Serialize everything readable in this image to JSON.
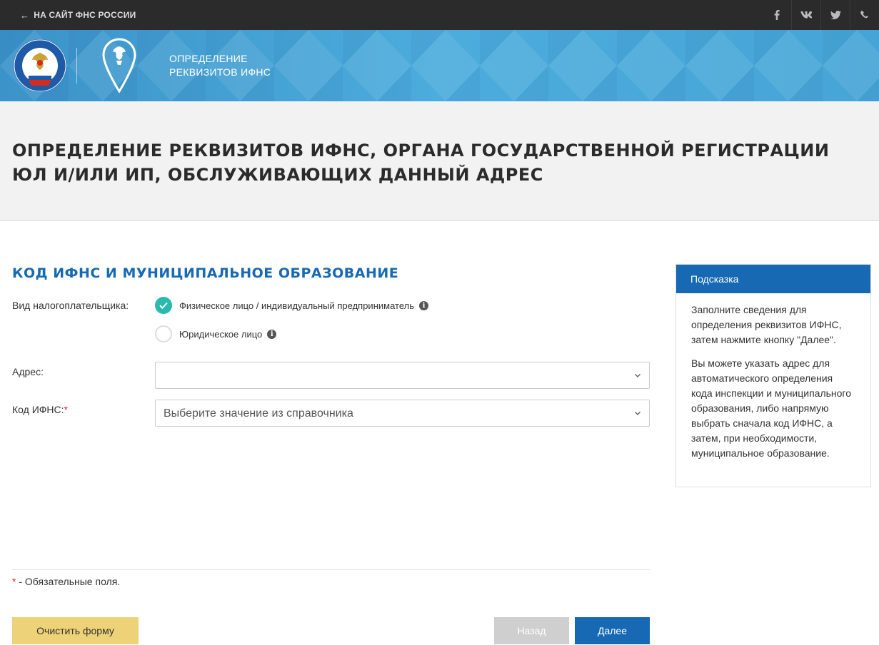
{
  "topbar": {
    "back_link": "НА САЙТ ФНС РОССИИ",
    "social": [
      {
        "icon": "facebook-icon",
        "glyph": "f"
      },
      {
        "icon": "vk-icon",
        "glyph": "vk"
      },
      {
        "icon": "twitter-icon",
        "glyph": "🐦"
      },
      {
        "icon": "phone-icon",
        "glyph": "📞"
      }
    ]
  },
  "banner": {
    "logo_text": "ФЕДЕРАЛЬНАЯ НАЛОГОВАЯ СЛУЖБА",
    "service_line1": "ОПРЕДЕЛЕНИЕ",
    "service_line2": "РЕКВИЗИТОВ ИФНС"
  },
  "page_title": "ОПРЕДЕЛЕНИЕ РЕКВИЗИТОВ ИФНС, ОРГАНА ГОСУДАРСТВЕННОЙ РЕГИСТРАЦИИ ЮЛ И/ИЛИ ИП, ОБСЛУЖИВАЮЩИХ ДАННЫЙ АДРЕС",
  "section_title": "КОД ИФНС И МУНИЦИПАЛЬНОЕ ОБРАЗОВАНИЕ",
  "form": {
    "taxpayer_type_label": "Вид налогоплательщика:",
    "options": [
      {
        "label": "Физическое лицо / индивидуальный предприниматель",
        "checked": true
      },
      {
        "label": "Юридическое лицо",
        "checked": false
      }
    ],
    "address_label": "Адрес:",
    "address_value": "",
    "ifns_label": "Код ИФНС:",
    "required_mark": "*",
    "ifns_placeholder": "Выберите значение из справочника",
    "required_note_mark": "*",
    "required_note": " - Обязательные поля."
  },
  "buttons": {
    "clear": "Очистить форму",
    "back": "Назад",
    "next": "Далее"
  },
  "hint": {
    "title": "Подсказка",
    "p1": "Заполните сведения для определения реквизитов ИФНС, затем нажмите кнопку \"Далее\".",
    "p2": "Вы можете указать адрес для автоматического определения кода инспекции и муниципального образования, либо напрямую выбрать сначала код ИФНС, а затем, при необходимости, муниципальное образование."
  },
  "colors": {
    "accent": "#1769b3",
    "check": "#2ab9ae",
    "clear_button": "#eed278",
    "required": "#d9262c"
  }
}
